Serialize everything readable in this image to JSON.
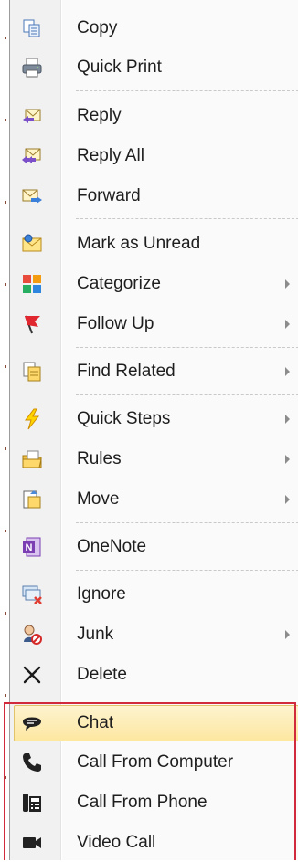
{
  "menu": {
    "items": [
      {
        "label": "Copy",
        "icon": "copy-icon",
        "submenu": false
      },
      {
        "label": "Quick Print",
        "icon": "printer-icon",
        "submenu": false
      },
      {
        "label": "Reply",
        "icon": "reply-icon",
        "submenu": false
      },
      {
        "label": "Reply All",
        "icon": "reply-all-icon",
        "submenu": false
      },
      {
        "label": "Forward",
        "icon": "forward-icon",
        "submenu": false
      },
      {
        "label": "Mark as Unread",
        "icon": "envelope-icon",
        "submenu": false
      },
      {
        "label": "Categorize",
        "icon": "categorize-icon",
        "submenu": true
      },
      {
        "label": "Follow Up",
        "icon": "flag-icon",
        "submenu": true
      },
      {
        "label": "Find Related",
        "icon": "find-related-icon",
        "submenu": true
      },
      {
        "label": "Quick Steps",
        "icon": "lightning-icon",
        "submenu": true
      },
      {
        "label": "Rules",
        "icon": "rules-icon",
        "submenu": true
      },
      {
        "label": "Move",
        "icon": "move-icon",
        "submenu": true
      },
      {
        "label": "OneNote",
        "icon": "onenote-icon",
        "submenu": false
      },
      {
        "label": "Ignore",
        "icon": "ignore-icon",
        "submenu": false
      },
      {
        "label": "Junk",
        "icon": "junk-icon",
        "submenu": true
      },
      {
        "label": "Delete",
        "icon": "delete-icon",
        "submenu": false
      },
      {
        "label": "Chat",
        "icon": "chat-bubble-icon",
        "submenu": false,
        "highlighted": true
      },
      {
        "label": "Call From Computer",
        "icon": "phone-icon",
        "submenu": false
      },
      {
        "label": "Call From Phone",
        "icon": "desk-phone-icon",
        "submenu": false
      },
      {
        "label": "Video Call",
        "icon": "video-camera-icon",
        "submenu": false
      }
    ]
  },
  "colors": {
    "highlight_border": "#e2c36a",
    "highlight_fill": "#fde7a0",
    "annotation_box": "#d02a3c"
  }
}
